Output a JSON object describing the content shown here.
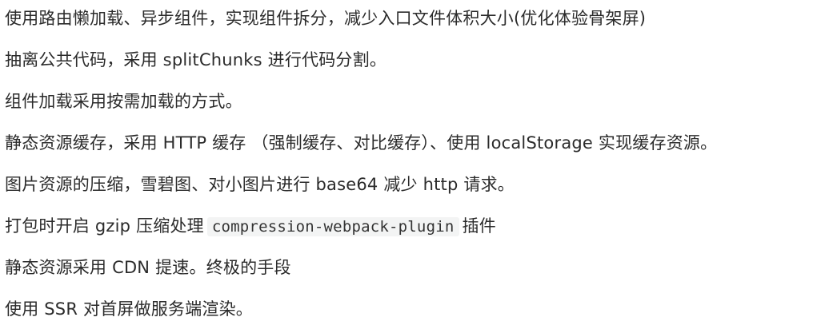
{
  "lines": [
    {
      "text": "使用路由懒加载、异步组件，实现组件拆分，减少入口文件体积大小(优化体验骨架屏)"
    },
    {
      "text": "抽离公共代码，采用 splitChunks 进行代码分割。"
    },
    {
      "text": "组件加载采用按需加载的方式。"
    },
    {
      "text": "静态资源缓存，采用 HTTP 缓存 （强制缓存、对比缓存）、使用 localStorage 实现缓存资源。"
    },
    {
      "text": "图片资源的压缩，雪碧图、对小图片进行 base64 减少 http 请求。"
    },
    {
      "before": "打包时开启 gzip 压缩处理",
      "code": "compression-webpack-plugin",
      "after": "插件"
    },
    {
      "text": "静态资源采用 CDN 提速。终极的手段"
    },
    {
      "text": "使用 SSR 对首屏做服务端渲染。"
    }
  ]
}
